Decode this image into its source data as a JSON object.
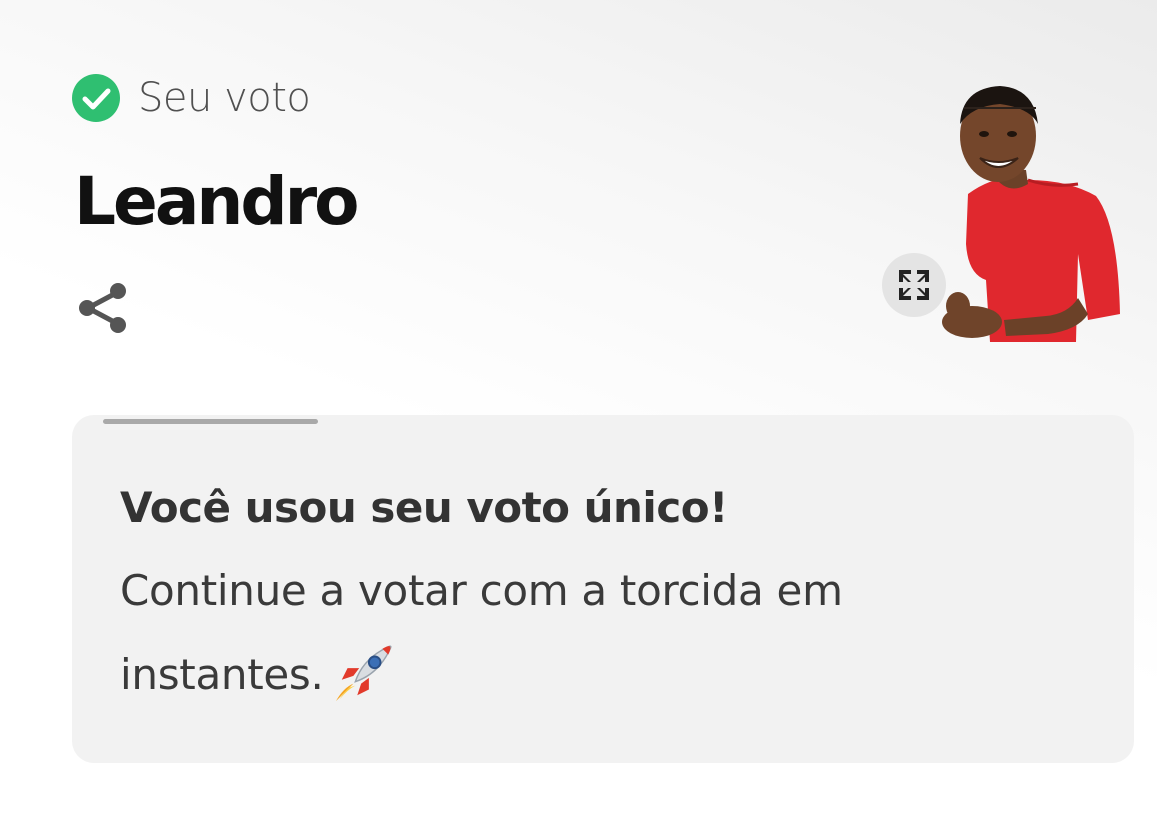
{
  "vote": {
    "status_label": "Seu voto",
    "status_icon": "check-circle-icon",
    "status_color": "#2fbf71"
  },
  "participant": {
    "name": "Leandro",
    "photo_icon": "participant-photo",
    "shirt_color": "#e0282e"
  },
  "actions": {
    "share_icon": "share-icon",
    "expand_icon": "expand-icon"
  },
  "message": {
    "progress": 0.45,
    "title": "Você usou seu voto único!",
    "body": "Continue a votar com a torcida em instantes.",
    "emoji_icon": "rocket-icon"
  }
}
